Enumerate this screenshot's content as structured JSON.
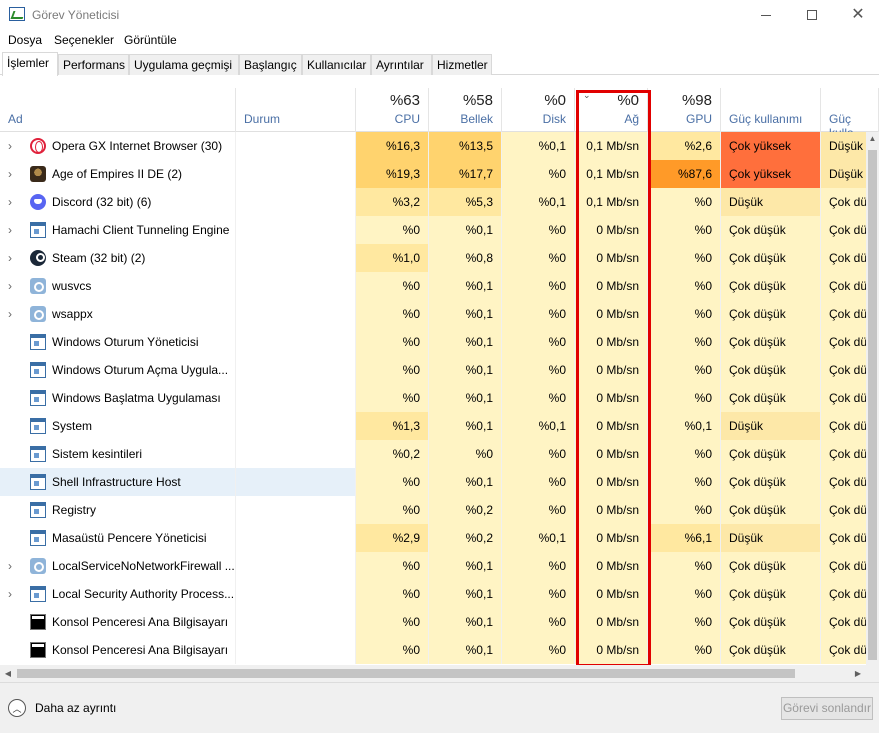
{
  "window": {
    "title": "Görev Yöneticisi",
    "minimize": "",
    "maximize": "",
    "close": "✕"
  },
  "menu": [
    "Dosya",
    "Seçenekler",
    "Görüntüle"
  ],
  "tabs": [
    {
      "label": "İşlemler",
      "active": true
    },
    {
      "label": "Performans"
    },
    {
      "label": "Uygulama geçmişi"
    },
    {
      "label": "Başlangıç"
    },
    {
      "label": "Kullanıcılar"
    },
    {
      "label": "Ayrıntılar"
    },
    {
      "label": "Hizmetler"
    }
  ],
  "columns": {
    "name": "Ad",
    "status": "Durum",
    "cpu": {
      "pct": "%63",
      "label": "CPU"
    },
    "memory": {
      "pct": "%58",
      "label": "Bellek"
    },
    "disk": {
      "pct": "%0",
      "label": "Disk"
    },
    "network": {
      "pct": "%0",
      "label": "Ağ"
    },
    "gpu": {
      "pct": "%98",
      "label": "GPU"
    },
    "power": "Güç kullanımı",
    "power_trend": "Güç kulla"
  },
  "processes": [
    {
      "name": "Opera GX Internet Browser (30)",
      "icon": "opera-icon",
      "expand": true,
      "cpu": "%16,3",
      "mem": "%13,5",
      "disk": "%0,1",
      "net": "0,1 Mb/sn",
      "gpu": "%2,6",
      "power": "Çok yüksek",
      "power_trend": "Düşük"
    },
    {
      "name": "Age of Empires II DE (2)",
      "icon": "aoe-icon",
      "expand": true,
      "cpu": "%19,3",
      "mem": "%17,7",
      "disk": "%0",
      "net": "0,1 Mb/sn",
      "gpu": "%87,6",
      "power": "Çok yüksek",
      "power_trend": "Düşük"
    },
    {
      "name": "Discord (32 bit) (6)",
      "icon": "discord-icon",
      "expand": true,
      "cpu": "%3,2",
      "mem": "%5,3",
      "disk": "%0,1",
      "net": "0,1 Mb/sn",
      "gpu": "%0",
      "power": "Düşük",
      "power_trend": "Çok dü"
    },
    {
      "name": "Hamachi Client Tunneling Engine",
      "icon": "window-icon",
      "expand": true,
      "cpu": "%0",
      "mem": "%0,1",
      "disk": "%0",
      "net": "0 Mb/sn",
      "gpu": "%0",
      "power": "Çok düşük",
      "power_trend": "Çok dü"
    },
    {
      "name": "Steam (32 bit) (2)",
      "icon": "steam-icon",
      "expand": true,
      "cpu": "%1,0",
      "mem": "%0,8",
      "disk": "%0",
      "net": "0 Mb/sn",
      "gpu": "%0",
      "power": "Çok düşük",
      "power_trend": "Çok dü"
    },
    {
      "name": "wusvcs",
      "icon": "gear-icon",
      "expand": true,
      "cpu": "%0",
      "mem": "%0,1",
      "disk": "%0",
      "net": "0 Mb/sn",
      "gpu": "%0",
      "power": "Çok düşük",
      "power_trend": "Çok dü"
    },
    {
      "name": "wsappx",
      "icon": "gear-icon",
      "expand": true,
      "cpu": "%0",
      "mem": "%0,1",
      "disk": "%0",
      "net": "0 Mb/sn",
      "gpu": "%0",
      "power": "Çok düşük",
      "power_trend": "Çok dü"
    },
    {
      "name": "Windows Oturum Yöneticisi",
      "icon": "window-icon",
      "expand": false,
      "cpu": "%0",
      "mem": "%0,1",
      "disk": "%0",
      "net": "0 Mb/sn",
      "gpu": "%0",
      "power": "Çok düşük",
      "power_trend": "Çok dü"
    },
    {
      "name": "Windows Oturum Açma Uygula...",
      "icon": "window-icon",
      "expand": false,
      "cpu": "%0",
      "mem": "%0,1",
      "disk": "%0",
      "net": "0 Mb/sn",
      "gpu": "%0",
      "power": "Çok düşük",
      "power_trend": "Çok dü"
    },
    {
      "name": "Windows Başlatma Uygulaması",
      "icon": "window-icon",
      "expand": false,
      "cpu": "%0",
      "mem": "%0,1",
      "disk": "%0",
      "net": "0 Mb/sn",
      "gpu": "%0",
      "power": "Çok düşük",
      "power_trend": "Çok dü"
    },
    {
      "name": "System",
      "icon": "window-icon",
      "expand": false,
      "cpu": "%1,3",
      "mem": "%0,1",
      "disk": "%0,1",
      "net": "0 Mb/sn",
      "gpu": "%0,1",
      "power": "Düşük",
      "power_trend": "Çok dü"
    },
    {
      "name": "Sistem kesintileri",
      "icon": "window-icon",
      "expand": false,
      "cpu": "%0,2",
      "mem": "%0",
      "disk": "%0",
      "net": "0 Mb/sn",
      "gpu": "%0",
      "power": "Çok düşük",
      "power_trend": "Çok dü"
    },
    {
      "name": "Shell Infrastructure Host",
      "icon": "window-icon",
      "expand": false,
      "selected": true,
      "cpu": "%0",
      "mem": "%0,1",
      "disk": "%0",
      "net": "0 Mb/sn",
      "gpu": "%0",
      "power": "Çok düşük",
      "power_trend": "Çok dü"
    },
    {
      "name": "Registry",
      "icon": "window-icon",
      "expand": false,
      "cpu": "%0",
      "mem": "%0,2",
      "disk": "%0",
      "net": "0 Mb/sn",
      "gpu": "%0",
      "power": "Çok düşük",
      "power_trend": "Çok dü"
    },
    {
      "name": "Masaüstü Pencere Yöneticisi",
      "icon": "window-icon",
      "expand": false,
      "cpu": "%2,9",
      "mem": "%0,2",
      "disk": "%0,1",
      "net": "0 Mb/sn",
      "gpu": "%6,1",
      "power": "Düşük",
      "power_trend": "Çok dü"
    },
    {
      "name": "LocalServiceNoNetworkFirewall ...",
      "icon": "gear-icon",
      "expand": true,
      "cpu": "%0",
      "mem": "%0,1",
      "disk": "%0",
      "net": "0 Mb/sn",
      "gpu": "%0",
      "power": "Çok düşük",
      "power_trend": "Çok dü"
    },
    {
      "name": "Local Security Authority Process...",
      "icon": "window-icon",
      "expand": true,
      "cpu": "%0",
      "mem": "%0,1",
      "disk": "%0",
      "net": "0 Mb/sn",
      "gpu": "%0",
      "power": "Çok düşük",
      "power_trend": "Çok dü"
    },
    {
      "name": "Konsol Penceresi Ana Bilgisayarı",
      "icon": "console-icon",
      "expand": false,
      "cpu": "%0",
      "mem": "%0,1",
      "disk": "%0",
      "net": "0 Mb/sn",
      "gpu": "%0",
      "power": "Çok düşük",
      "power_trend": "Çok dü"
    },
    {
      "name": "Konsol Penceresi Ana Bilgisayarı",
      "icon": "console-icon",
      "expand": false,
      "cpu": "%0",
      "mem": "%0,1",
      "disk": "%0",
      "net": "0 Mb/sn",
      "gpu": "%0",
      "power": "Çok düşük",
      "power_trend": "Çok dü"
    }
  ],
  "footer": {
    "fewer_details": "Daha az ayrıntı",
    "end_task": "Görevi sonlandır"
  },
  "colors": {
    "heat_low": "#fff4c4",
    "heat_mid": "#ffe8a0",
    "heat_high": "#ffd36e",
    "heat_max": "#ff9a28",
    "power_very_high": "#ff6f3c",
    "power_low": "#fde8a8",
    "highlight_box": "#e10000"
  }
}
